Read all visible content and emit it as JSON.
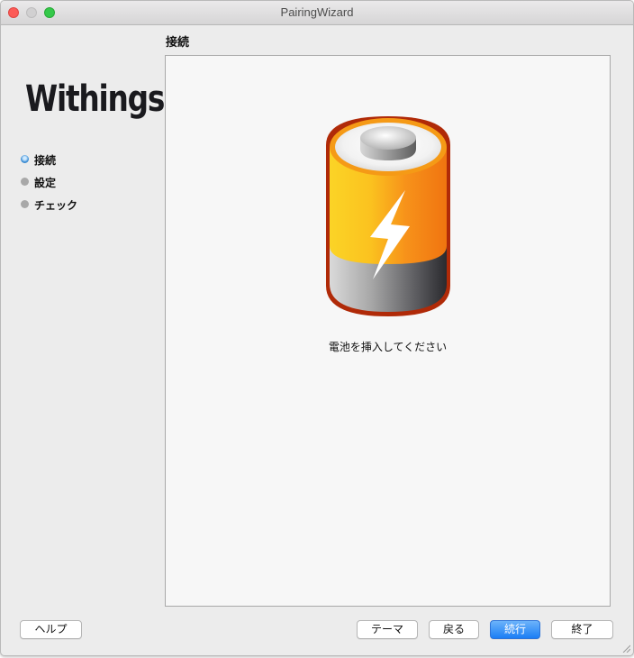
{
  "window": {
    "title": "PairingWizard"
  },
  "sidebar": {
    "logo": "Withings",
    "steps": [
      {
        "label": "接続",
        "state": "active"
      },
      {
        "label": "設定",
        "state": "pending"
      },
      {
        "label": "チェック",
        "state": "pending"
      }
    ]
  },
  "main": {
    "heading": "接続",
    "illustration_icon": "battery-charging-icon",
    "instruction": "電池を挿入してください"
  },
  "buttons": {
    "help": "ヘルプ",
    "theme": "テーマ",
    "back": "戻る",
    "continue": "続行",
    "quit": "終了"
  },
  "colors": {
    "primary_button": "#1b7ef5",
    "active_step": "#3d8fd6",
    "battery_top": "#f5a31a",
    "battery_outline": "#b02a08"
  }
}
